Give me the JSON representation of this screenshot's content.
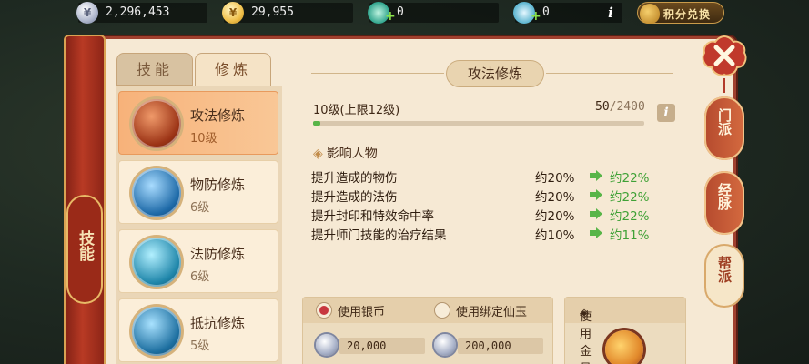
{
  "currency": {
    "silver": "2,296,453",
    "gold": "29,955",
    "jade": "0",
    "bound_jade": "0",
    "exchange_label": "积分兑换"
  },
  "side_scroll": {
    "label": "技能"
  },
  "tabs": [
    {
      "label": "技能",
      "active": false
    },
    {
      "label": "修炼",
      "active": true
    }
  ],
  "skills": [
    {
      "name": "攻法修炼",
      "level": "10级",
      "selected": true,
      "color": "#c24a20"
    },
    {
      "name": "物防修炼",
      "level": "6级",
      "selected": false,
      "color": "#1d6aa6"
    },
    {
      "name": "法防修炼",
      "level": "6级",
      "selected": false,
      "color": "#1e7fa3"
    },
    {
      "name": "抵抗修炼",
      "level": "5级",
      "selected": false,
      "color": "#1c6c9c"
    }
  ],
  "detail": {
    "title": "攻法修炼",
    "level_text": "10级(上限12级)",
    "progress_current": "50",
    "progress_max": "/2400",
    "progress_fraction": 0.021,
    "section_title": "影响人物",
    "effects": [
      {
        "label": "提升造成的物伤",
        "current": "约20%",
        "next": "约22%"
      },
      {
        "label": "提升造成的法伤",
        "current": "约20%",
        "next": "约22%"
      },
      {
        "label": "提升封印和特效命中率",
        "current": "约20%",
        "next": "约22%"
      },
      {
        "label": "提升师门技能的治疗结果",
        "current": "约10%",
        "next": "约11%"
      }
    ]
  },
  "cost": {
    "option1_label": "使用银币",
    "option2_label": "使用绑定仙玉",
    "amount1": "20,000",
    "amount2": "200,000",
    "pill_label": "使用金丹"
  },
  "right_tabs": [
    {
      "label": "门派",
      "active": false
    },
    {
      "label": "经脉",
      "active": false
    },
    {
      "label": "帮派",
      "active": true
    }
  ]
}
